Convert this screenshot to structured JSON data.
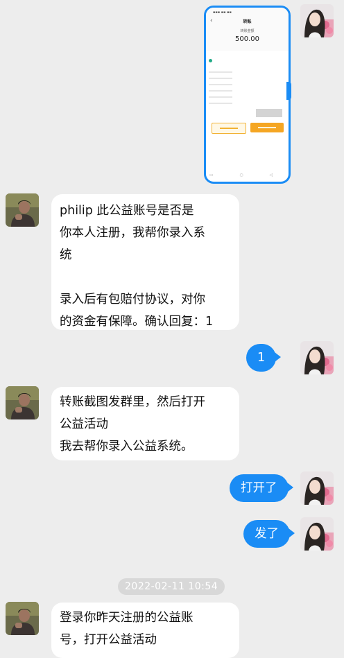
{
  "screenshot": {
    "title": "转账",
    "caption": "转账金额",
    "amount": "500.00",
    "icons": {
      "back": "chevron-left-icon"
    }
  },
  "messages": [
    {
      "side": "in",
      "lines": [
        "philip    此公益账号是否是",
        "你本人注册，我帮你录入系",
        "统",
        "",
        "录入后有包赔付协议，对你",
        "的资金有保障。确认回复：1"
      ]
    },
    {
      "side": "out",
      "lines": [
        "1"
      ]
    },
    {
      "side": "in",
      "lines": [
        "转账截图发群里，然后打开",
        "公益活动",
        "我去帮你录入公益系统。"
      ]
    },
    {
      "side": "out",
      "lines": [
        "打开了"
      ]
    },
    {
      "side": "out",
      "lines": [
        "发了"
      ]
    },
    {
      "side": "in",
      "lines": [
        "登录你昨天注册的公益账",
        "号，打开公益活动"
      ]
    }
  ],
  "timestamp": "2022-02-11 10:54",
  "colors": {
    "outgoing_bubble": "#1a8cf5",
    "incoming_bubble": "#ffffff",
    "background": "#ededed"
  }
}
